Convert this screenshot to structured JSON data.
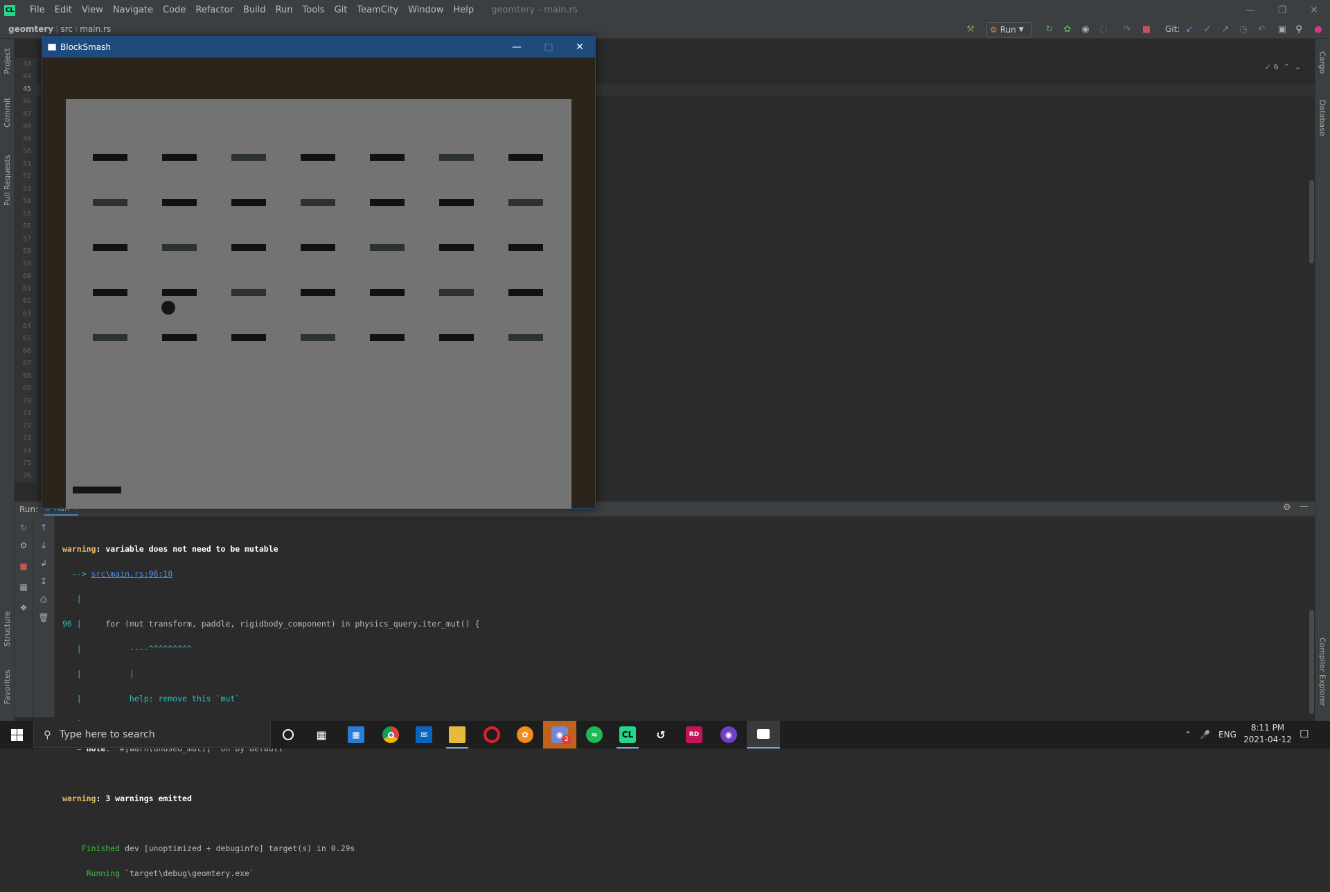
{
  "menu": {
    "logo": "CL",
    "items": [
      "File",
      "Edit",
      "View",
      "Navigate",
      "Code",
      "Refactor",
      "Build",
      "Run",
      "Tools",
      "Git",
      "TeamCity",
      "Window",
      "Help"
    ],
    "window_title": "geomtery - main.rs"
  },
  "breadcrumb": {
    "project": "geomtery",
    "folder": "src",
    "file": "main.rs"
  },
  "toolbar": {
    "run_config": "Run",
    "git_label": "Git:"
  },
  "left_tabs": {
    "project": "Project",
    "commit": "Commit",
    "pull_requests": "Pull Requests",
    "structure": "Structure",
    "favorites": "Favorites"
  },
  "right_tabs": {
    "cargo": "Cargo",
    "database": "Database",
    "compiler_explorer": "Compiler Explorer"
  },
  "editor": {
    "line_numbers": [
      "43",
      "44",
      "45",
      "46",
      "47",
      "48",
      "49",
      "50",
      "51",
      "52",
      "53",
      "54",
      "55",
      "56",
      "57",
      "58",
      "59",
      "60",
      "61",
      "62",
      "63",
      "64",
      "65",
      "66",
      "67",
      "68",
      "69",
      "70",
      "71",
      "72",
      "73",
      "74",
      "75",
      "76"
    ],
    "current_line": "45",
    "inspection_count": "6"
  },
  "run_panel": {
    "label": "Run:",
    "tab": "Run"
  },
  "console": {
    "l1_warn": "warning",
    "l1_text": ": variable does not need to be mutable",
    "l2_arrow": "  --> ",
    "l2_link": "src\\main.rs:96:10",
    "l3": "   |",
    "l4_num": "96",
    "l4_bar": " |",
    "l4_code": "     for (mut transform, paddle, rigidbody_component) in physics_query.iter_mut() {",
    "l5": "   |          ----^^^^^^^^^",
    "l6": "   |          |",
    "l7": "   |          help: remove this `mut`",
    "l8": "   |",
    "l9_eq": "   = ",
    "l9_note": "note",
    "l9_text": ": `#[warn(unused_mut)]` on by default",
    "l10_warn": "warning",
    "l10_text": ": 3 warnings emitted",
    "l11_status": "    Finished",
    "l11_text": " dev [unoptimized + debuginfo] target(s) in 0.29s",
    "l12_status": "     Running",
    "l12_text": " `target\\debug\\geomtery.exe`"
  },
  "game_window": {
    "title": "BlockSmash",
    "bricks": [
      [
        "dark",
        "dark",
        "light",
        "dark",
        "dark",
        "light",
        "dark"
      ],
      [
        "light",
        "dark",
        "dark",
        "light",
        "dark",
        "dark",
        "light"
      ],
      [
        "dark",
        "light",
        "dark",
        "dark",
        "light",
        "dark",
        "dark"
      ],
      [
        "dark",
        "dark",
        "light",
        "dark",
        "dark",
        "light",
        "dark"
      ],
      [
        "light",
        "dark",
        "dark",
        "light",
        "dark",
        "dark",
        "light"
      ]
    ]
  },
  "taskbar": {
    "search_placeholder": "Type here to search",
    "apps": [
      "cortana",
      "task-view",
      "store",
      "chrome",
      "mail",
      "file-explorer",
      "opera",
      "fl-studio",
      "discord",
      "spotify",
      "clion",
      "visual-studio",
      "rider",
      "github-desktop",
      "blocksmash"
    ],
    "discord_badge": "2",
    "language": "ENG",
    "time": "8:11 PM",
    "date": "2021-04-12"
  }
}
